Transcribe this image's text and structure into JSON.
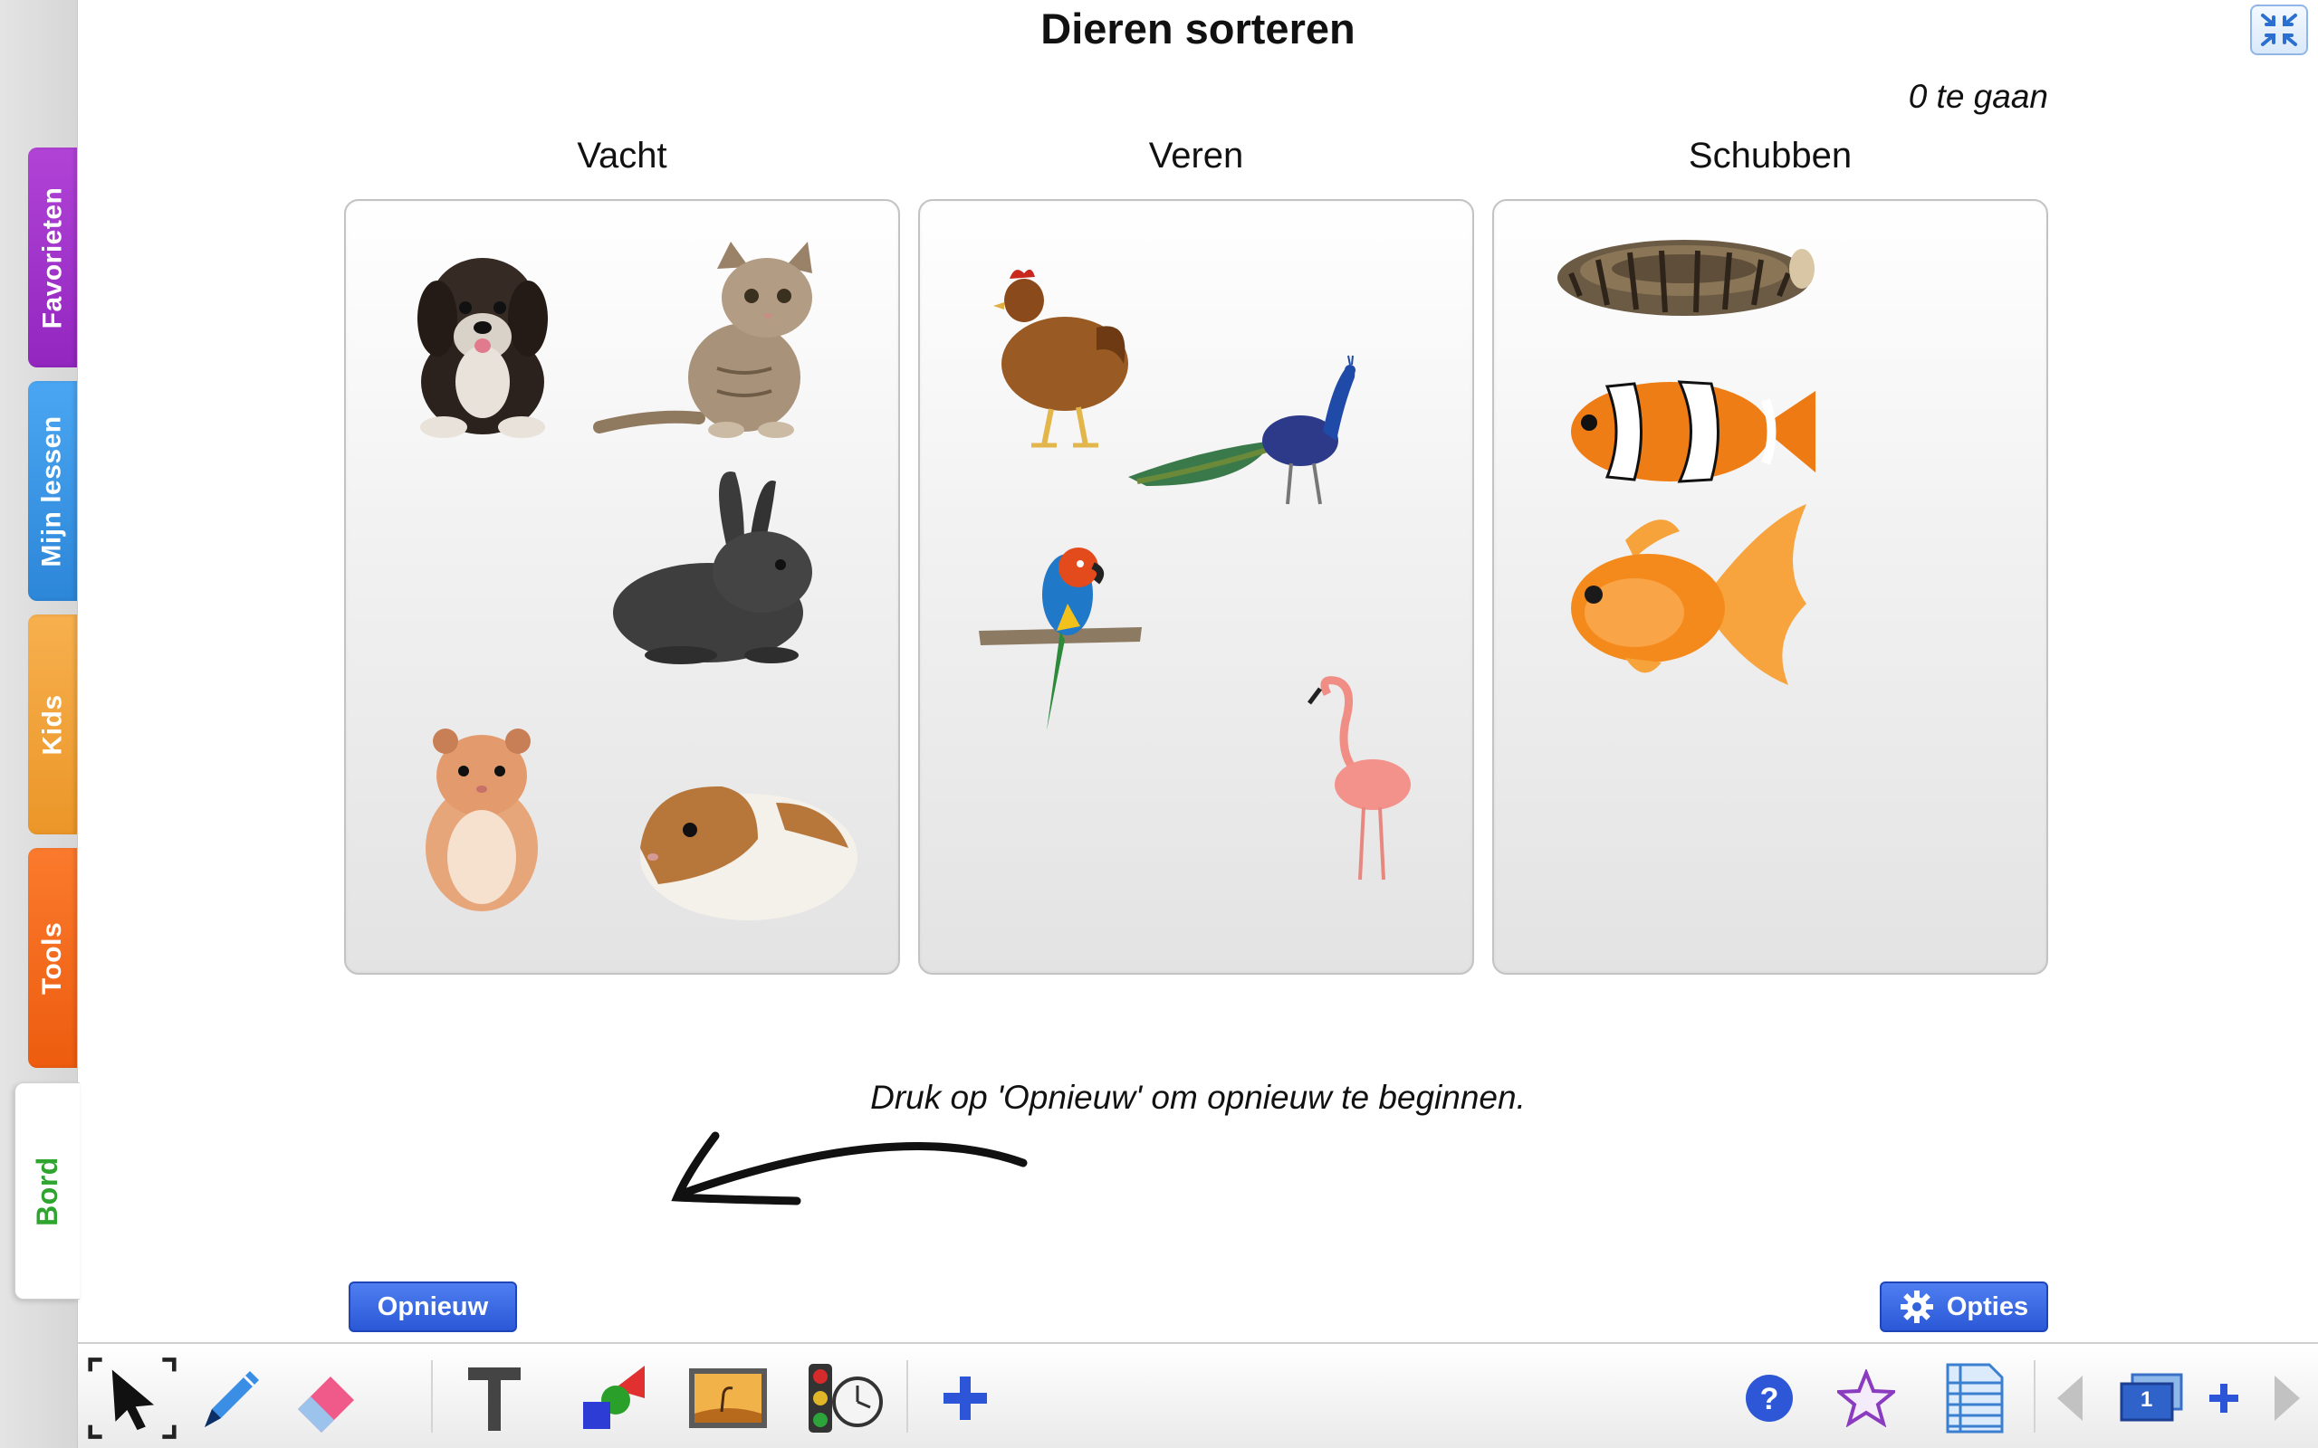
{
  "title": "Dieren sorteren",
  "remaining": "0 te gaan",
  "tabs": {
    "favorieten": "Favorieten",
    "mijn_lessen": "Mijn lessen",
    "kids": "Kids",
    "tools": "Tools",
    "bord": "Bord"
  },
  "columns": [
    {
      "label": "Vacht",
      "items": [
        "dog",
        "cat",
        "rabbit",
        "hamster",
        "guinea-pig"
      ]
    },
    {
      "label": "Veren",
      "items": [
        "chicken",
        "peacock",
        "parrot",
        "flamingo"
      ]
    },
    {
      "label": "Schubben",
      "items": [
        "snake",
        "clownfish",
        "goldfish"
      ]
    }
  ],
  "hint": "Druk op 'Opnieuw' om opnieuw te beginnen.",
  "buttons": {
    "opnieuw": "Opnieuw",
    "opties": "Opties"
  },
  "page_indicator": "1",
  "colors": {
    "favorieten": "#a235cc",
    "mijn_lessen": "#3a95e4",
    "kids": "#f1a13a",
    "tools": "#f46a1e",
    "bord_label": "#2fa52f",
    "button": "#3a68e2"
  },
  "toolbar_icons": [
    "select-arrow-icon",
    "pen-icon",
    "eraser-icon",
    "text-icon",
    "shapes-icon",
    "image-icon",
    "traffic-light-timer-icon",
    "add-widget-icon",
    "help-icon",
    "star-icon",
    "notes-icon",
    "prev-page-icon",
    "page-icon",
    "add-page-icon",
    "next-page-icon"
  ]
}
